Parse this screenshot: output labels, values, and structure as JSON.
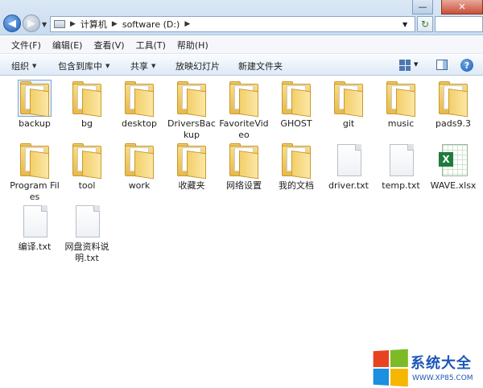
{
  "window": {
    "min_symbol": "—",
    "close_symbol": "✕"
  },
  "address": {
    "crumbs": [
      "计算机",
      "software (D:)"
    ]
  },
  "menu": [
    "文件(F)",
    "编辑(E)",
    "查看(V)",
    "工具(T)",
    "帮助(H)"
  ],
  "toolbar": {
    "organize": "组织",
    "include_library": "包含到库中",
    "share": "共享",
    "slideshow": "放映幻灯片",
    "new_folder": "新建文件夹",
    "help_symbol": "?"
  },
  "items": [
    {
      "label": "backup",
      "kind": "folder",
      "selected": true
    },
    {
      "label": "bg",
      "kind": "folder"
    },
    {
      "label": "desktop",
      "kind": "folder"
    },
    {
      "label": "DriversBackup",
      "kind": "folder"
    },
    {
      "label": "FavoriteVideo",
      "kind": "folder"
    },
    {
      "label": "GHOST",
      "kind": "folder"
    },
    {
      "label": "git",
      "kind": "folder"
    },
    {
      "label": "music",
      "kind": "folder"
    },
    {
      "label": "pads9.3",
      "kind": "folder"
    },
    {
      "label": "Program Files",
      "kind": "folder"
    },
    {
      "label": "tool",
      "kind": "folder"
    },
    {
      "label": "work",
      "kind": "folder"
    },
    {
      "label": "收藏夹",
      "kind": "folder"
    },
    {
      "label": "网络设置",
      "kind": "folder"
    },
    {
      "label": "我的文档",
      "kind": "folder"
    },
    {
      "label": "driver.txt",
      "kind": "txt"
    },
    {
      "label": "temp.txt",
      "kind": "txt"
    },
    {
      "label": "WAVE.xlsx",
      "kind": "xlsx"
    },
    {
      "label": "编译.txt",
      "kind": "txt"
    },
    {
      "label": "网盘资料说明.txt",
      "kind": "txt"
    }
  ],
  "watermark": {
    "brand": "系统大全",
    "url": "WWW.XP85.COM",
    "colors": [
      "#e8431f",
      "#7cbb26",
      "#1b8fe0",
      "#f6b700"
    ]
  }
}
